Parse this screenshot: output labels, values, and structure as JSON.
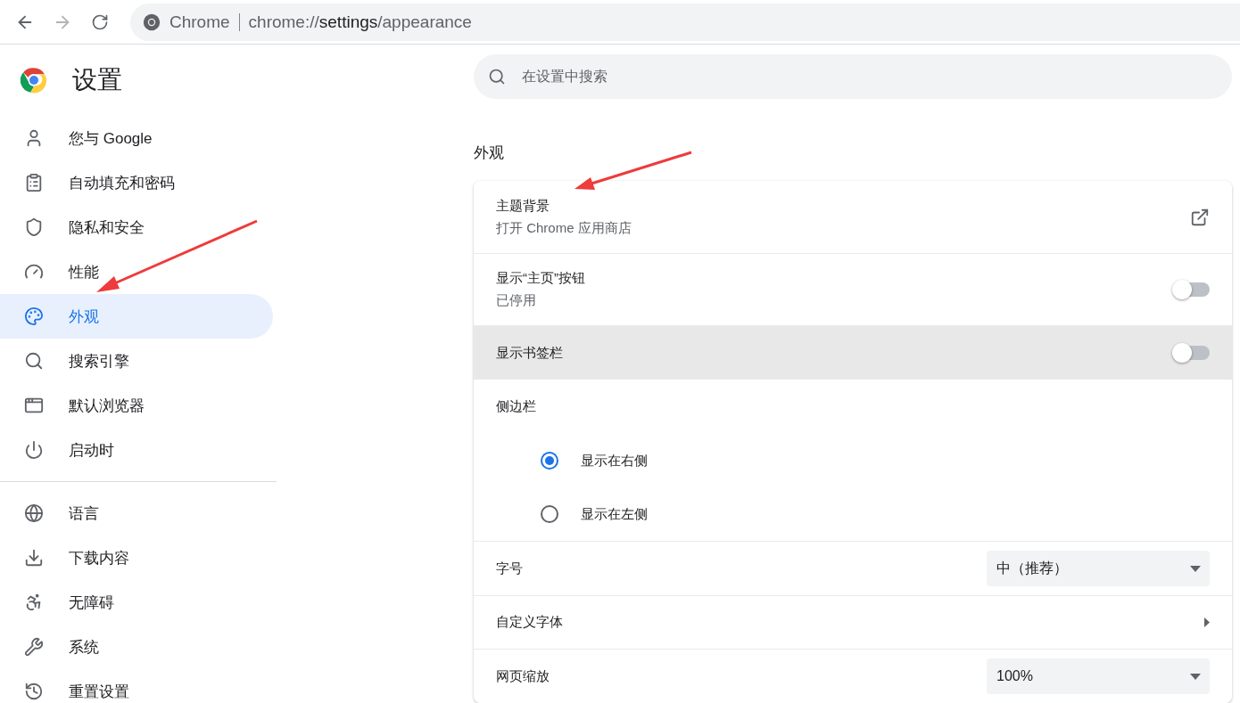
{
  "toolbar": {
    "back_enabled": true,
    "forward_enabled": false,
    "site_label": "Chrome",
    "url": {
      "scheme": "chrome://",
      "host": "settings",
      "path": "/appearance"
    }
  },
  "sidebar": {
    "title": "设置",
    "groups": [
      [
        {
          "kind": "person",
          "label": "您与 Google",
          "selected": false
        },
        {
          "kind": "clipboard",
          "label": "自动填充和密码",
          "selected": false
        },
        {
          "kind": "shield",
          "label": "隐私和安全",
          "selected": false
        },
        {
          "kind": "gauge",
          "label": "性能",
          "selected": false
        },
        {
          "kind": "palette",
          "label": "外观",
          "selected": true
        },
        {
          "kind": "search",
          "label": "搜索引擎",
          "selected": false
        },
        {
          "kind": "window",
          "label": "默认浏览器",
          "selected": false
        },
        {
          "kind": "power",
          "label": "启动时",
          "selected": false
        }
      ],
      [
        {
          "kind": "globe",
          "label": "语言",
          "selected": false
        },
        {
          "kind": "download",
          "label": "下载内容",
          "selected": false
        },
        {
          "kind": "accessibility",
          "label": "无障碍",
          "selected": false
        },
        {
          "kind": "wrench",
          "label": "系统",
          "selected": false
        },
        {
          "kind": "history",
          "label": "重置设置",
          "selected": false
        }
      ]
    ]
  },
  "search": {
    "placeholder": "在设置中搜索"
  },
  "section": {
    "title": "外观",
    "rows": [
      {
        "kind": "link",
        "title": "主题背景",
        "subtitle": "打开 Chrome 应用商店",
        "hovered": false
      },
      {
        "kind": "toggle",
        "title": "显示“主页”按钮",
        "subtitle": "已停用",
        "on": false,
        "hovered": false
      },
      {
        "kind": "toggle",
        "title": "显示书签栏",
        "on": false,
        "hovered": true
      },
      {
        "kind": "heading",
        "title": "侧边栏"
      },
      {
        "kind": "radio",
        "title": "显示在右侧",
        "selected": true
      },
      {
        "kind": "radio",
        "title": "显示在左侧",
        "selected": false
      },
      {
        "kind": "select",
        "title": "字号",
        "value": "中（推荐）",
        "hovered": false
      },
      {
        "kind": "submenu",
        "title": "自定义字体",
        "hovered": false
      },
      {
        "kind": "select",
        "title": "网页缩放",
        "value": "100%",
        "hovered": false
      }
    ]
  }
}
